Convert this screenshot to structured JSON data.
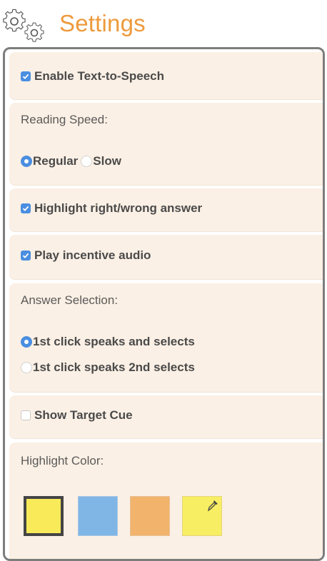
{
  "header": {
    "title": "Settings",
    "icon": "gears-icon",
    "title_color": "#ee9a3c"
  },
  "settings": {
    "tts": {
      "label": "Enable Text-to-Speech",
      "checked": true
    },
    "reading_speed": {
      "label": "Reading Speed:",
      "options": [
        {
          "label": "Regular",
          "selected": true
        },
        {
          "label": "Slow",
          "selected": false
        }
      ]
    },
    "highlight_answer": {
      "label": "Highlight right/wrong answer",
      "checked": true
    },
    "incentive_audio": {
      "label": "Play incentive audio",
      "checked": true
    },
    "answer_selection": {
      "label": "Answer Selection:",
      "options": [
        {
          "label": "1st click speaks and selects",
          "selected": true
        },
        {
          "label": "1st click speaks 2nd selects",
          "selected": false
        }
      ]
    },
    "target_cue": {
      "label": "Show Target Cue",
      "checked": false
    },
    "highlight_color": {
      "label": "Highlight Color:",
      "swatches": [
        {
          "color": "#f9ea5a",
          "selected": true
        },
        {
          "color": "#7fb6e6",
          "selected": false
        },
        {
          "color": "#f2b36c",
          "selected": false
        },
        {
          "color": "#f8ee64",
          "selected": false,
          "icon": "eyedropper-icon"
        }
      ]
    }
  },
  "colors": {
    "accent": "#4a8ee0",
    "section_bg": "#fbf0e5",
    "panel_border": "#7d7d7d"
  }
}
